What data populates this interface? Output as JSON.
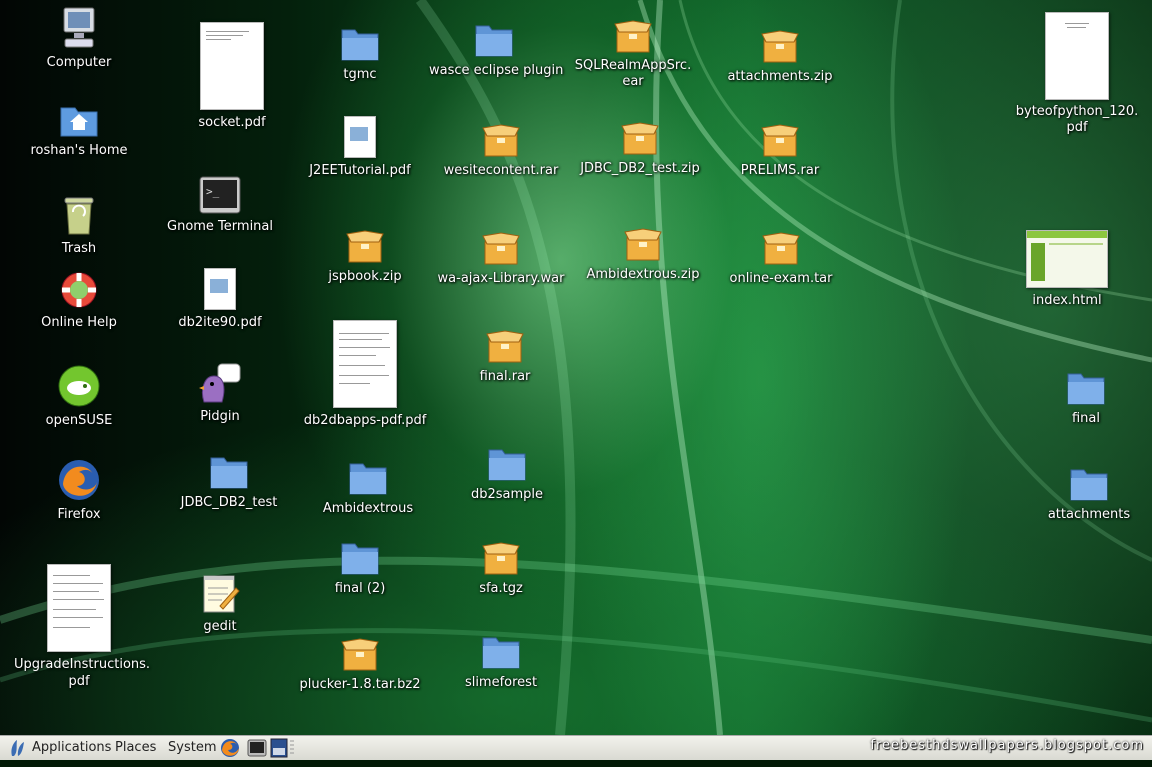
{
  "desktop": {
    "col1": {
      "computer": "Computer",
      "home": "roshan's Home",
      "trash": "Trash",
      "help": "Online Help",
      "opensuse": "openSUSE",
      "firefox": "Firefox",
      "upgrade": "UpgradeInstructions.\npdf"
    },
    "col2": {
      "socket": "socket.pdf",
      "terminal": "Gnome Terminal",
      "db2ite": "db2ite90.pdf",
      "pidgin": "Pidgin",
      "jdbc_folder": "JDBC_DB2_test",
      "gedit": "gedit"
    },
    "col3": {
      "tgmc": "tgmc",
      "j2ee": "J2EETutorial.pdf",
      "jspbook": "jspbook.zip",
      "db2dbapps": "db2dbapps-pdf.pdf",
      "ambi_folder": "Ambidextrous",
      "final2": "final (2)",
      "plucker": "plucker-1.8.tar.bz2"
    },
    "col4": {
      "wasce": "wasce eclipse plugin",
      "wesite": "wesitecontent.rar",
      "waajax": "wa-ajax-Library.war",
      "finalrar": "final.rar",
      "db2sample": "db2sample",
      "sfa": "sfa.tgz",
      "slimeforest": "slimeforest"
    },
    "col5": {
      "sqlrealm": "SQLRealmAppSrc.\near",
      "jdbczip": "JDBC_DB2_test.zip",
      "ambizip": "Ambidextrous.zip"
    },
    "col6": {
      "attachzip": "attachments.zip",
      "prelims": "PRELIMS.rar",
      "onlineexam": "online-exam.tar"
    },
    "col7": {
      "byteofpython": "byteofpython_120.\npdf",
      "index": "index.html",
      "final": "final",
      "attachments": "attachments"
    }
  },
  "panel": {
    "applications": "Applications",
    "places": "Places",
    "system": "System",
    "watermark": "freebesthdswallpapers.blogspot.com"
  },
  "colors": {
    "folder": "#6fa8e8",
    "archive": "#f0b040",
    "panel": "#e6e6df"
  },
  "icons": {
    "folder": "folder-icon",
    "archive": "archive-box-icon",
    "pdf": "pdf-document-icon",
    "computer": "computer-icon",
    "home": "home-folder-icon",
    "trash": "trash-icon",
    "help": "help-lifebuoy-icon",
    "opensuse": "opensuse-gecko-icon",
    "firefox": "firefox-icon",
    "terminal": "terminal-icon",
    "pidgin": "pidgin-icon",
    "gedit": "gedit-notepad-icon",
    "html": "html-document-icon"
  }
}
